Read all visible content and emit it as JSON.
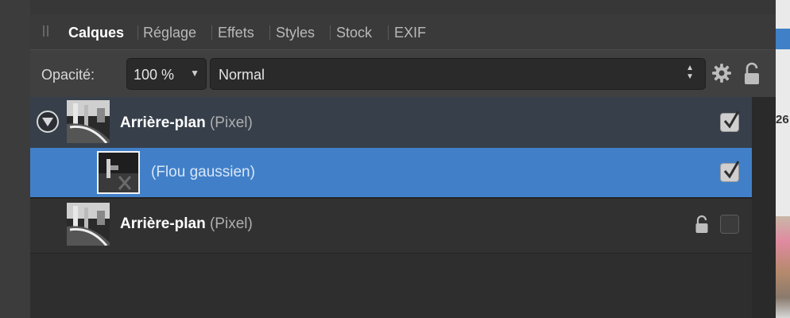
{
  "tabs": [
    {
      "label": "Calques",
      "active": true
    },
    {
      "label": "Réglage",
      "active": false
    },
    {
      "label": "Effets",
      "active": false
    },
    {
      "label": "Styles",
      "active": false
    },
    {
      "label": "Stock",
      "active": false
    },
    {
      "label": "EXIF",
      "active": false
    }
  ],
  "toolbar": {
    "opacity_label": "Opacité:",
    "opacity_value": "100 %",
    "blend_mode": "Normal",
    "settings_icon": "gear-icon",
    "lock_icon": "lock-icon"
  },
  "layers": [
    {
      "name": "Arrière-plan",
      "type": "(Pixel)",
      "expanded": true,
      "visible": true,
      "locked": false,
      "children": [
        {
          "name": "(Flou gaussien)",
          "selected": true,
          "visible": true
        }
      ]
    },
    {
      "name": "Arrière-plan",
      "type": "(Pixel)",
      "expanded": false,
      "visible": false,
      "locked": true
    }
  ],
  "right_edge_text": "26",
  "colors": {
    "selection": "#4180c9",
    "panel_bg": "#2e2e2e",
    "parent_row_bg": "#363f4a"
  }
}
